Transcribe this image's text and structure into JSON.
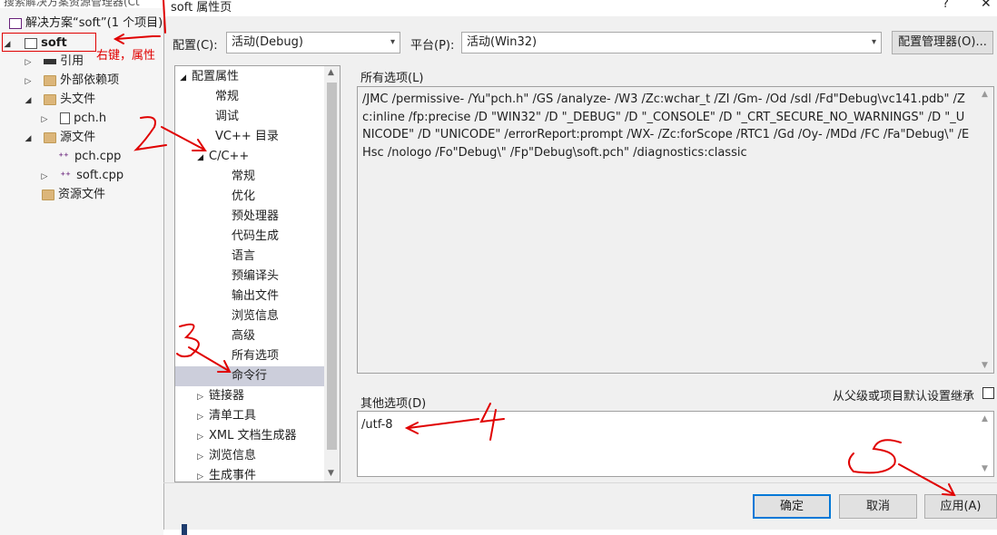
{
  "explorer": {
    "top_cut_text": "搜索解决方案资源管理器(Ct",
    "solution_label": "解决方案“soft”(1 个项目)",
    "project_label": "soft",
    "items": [
      {
        "label": "引用"
      },
      {
        "label": "外部依赖项"
      },
      {
        "label": "头文件"
      },
      {
        "label": "pch.h"
      },
      {
        "label": "源文件"
      },
      {
        "label": "pch.cpp"
      },
      {
        "label": "soft.cpp"
      },
      {
        "label": "资源文件"
      }
    ]
  },
  "dialog": {
    "title": "soft 属性页",
    "help": "?",
    "close": "✕",
    "config_label": "配置(C):",
    "config_value": "活动(Debug)",
    "platform_label": "平台(P):",
    "platform_value": "活动(Win32)",
    "config_manager": "配置管理器(O)...",
    "tree": [
      {
        "label": "配置属性",
        "tri": "◢"
      },
      {
        "label": "常规"
      },
      {
        "label": "调试"
      },
      {
        "label": "VC++ 目录"
      },
      {
        "label": "C/C++",
        "tri": "◢"
      },
      {
        "label": "常规"
      },
      {
        "label": "优化"
      },
      {
        "label": "预处理器"
      },
      {
        "label": "代码生成"
      },
      {
        "label": "语言"
      },
      {
        "label": "预编译头"
      },
      {
        "label": "输出文件"
      },
      {
        "label": "浏览信息"
      },
      {
        "label": "高级"
      },
      {
        "label": "所有选项"
      },
      {
        "label": "命令行"
      },
      {
        "label": "链接器",
        "tri": "▷"
      },
      {
        "label": "清单工具",
        "tri": "▷"
      },
      {
        "label": "XML 文档生成器",
        "tri": "▷"
      },
      {
        "label": "浏览信息",
        "tri": "▷"
      },
      {
        "label": "生成事件",
        "tri": "▷"
      }
    ],
    "all_options_label": "所有选项(L)",
    "all_options_text": "/JMC /permissive- /Yu\"pch.h\" /GS /analyze- /W3 /Zc:wchar_t /ZI /Gm- /Od /sdl /Fd\"Debug\\vc141.pdb\" /Zc:inline /fp:precise /D \"WIN32\" /D \"_DEBUG\" /D \"_CONSOLE\" /D \"_CRT_SECURE_NO_WARNINGS\" /D \"_UNICODE\" /D \"UNICODE\" /errorReport:prompt /WX- /Zc:forScope /RTC1 /Gd /Oy- /MDd /FC /Fa\"Debug\\\" /EHsc /nologo /Fo\"Debug\\\" /Fp\"Debug\\soft.pch\" /diagnostics:classic",
    "inherit_label": "从父级或项目默认设置继承",
    "other_options_label": "其他选项(D)",
    "other_options_value": "/utf-8",
    "ok": "确定",
    "cancel": "取消",
    "apply": "应用(A)"
  },
  "annotations": {
    "right_click_note": "右键，属性"
  },
  "colors": {
    "annotation": "#e00000",
    "selection": "#cccedb",
    "dialog_bg": "#f0f0f0",
    "primary_border": "#0078d7"
  }
}
